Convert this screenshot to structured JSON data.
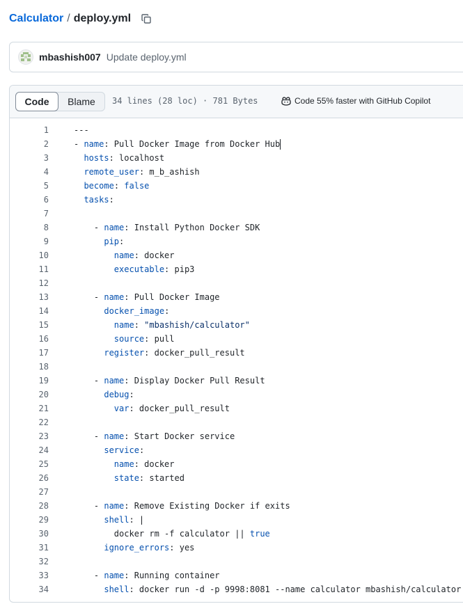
{
  "breadcrumb": {
    "repo": "Calculator",
    "separator": "/",
    "file": "deploy.yml"
  },
  "commit": {
    "author": "mbashish007",
    "message": "Update deploy.yml"
  },
  "file_header": {
    "tab_code": "Code",
    "tab_blame": "Blame",
    "meta": "34 lines (28 loc) · 781 Bytes",
    "copilot": "Code 55% faster with GitHub Copilot"
  },
  "colors": {
    "link": "#0969da",
    "yaml_key": "#0550ae",
    "yaml_string": "#0a3069",
    "text": "#1f2328",
    "muted": "#59636e",
    "border": "#d1d9e0"
  },
  "code_lines": [
    {
      "n": "1",
      "parts": [
        [
          "t",
          "---"
        ]
      ]
    },
    {
      "n": "2",
      "parts": [
        [
          "t",
          "- "
        ],
        [
          "k",
          "name"
        ],
        [
          "t",
          ": Pull Docker Image from Docker Hub"
        ]
      ],
      "caret": true
    },
    {
      "n": "3",
      "parts": [
        [
          "t",
          "  "
        ],
        [
          "k",
          "hosts"
        ],
        [
          "t",
          ": localhost"
        ]
      ]
    },
    {
      "n": "4",
      "parts": [
        [
          "t",
          "  "
        ],
        [
          "k",
          "remote_user"
        ],
        [
          "t",
          ": m_b_ashish"
        ]
      ]
    },
    {
      "n": "5",
      "parts": [
        [
          "t",
          "  "
        ],
        [
          "k",
          "become"
        ],
        [
          "t",
          ": "
        ],
        [
          "b",
          "false"
        ]
      ]
    },
    {
      "n": "6",
      "parts": [
        [
          "t",
          "  "
        ],
        [
          "k",
          "tasks"
        ],
        [
          "t",
          ":"
        ]
      ]
    },
    {
      "n": "7",
      "parts": []
    },
    {
      "n": "8",
      "parts": [
        [
          "t",
          "    - "
        ],
        [
          "k",
          "name"
        ],
        [
          "t",
          ": Install Python Docker SDK"
        ]
      ]
    },
    {
      "n": "9",
      "parts": [
        [
          "t",
          "      "
        ],
        [
          "k",
          "pip"
        ],
        [
          "t",
          ":"
        ]
      ]
    },
    {
      "n": "10",
      "parts": [
        [
          "t",
          "        "
        ],
        [
          "k",
          "name"
        ],
        [
          "t",
          ": docker"
        ]
      ]
    },
    {
      "n": "11",
      "parts": [
        [
          "t",
          "        "
        ],
        [
          "k",
          "executable"
        ],
        [
          "t",
          ": pip3"
        ]
      ]
    },
    {
      "n": "12",
      "parts": []
    },
    {
      "n": "13",
      "parts": [
        [
          "t",
          "    - "
        ],
        [
          "k",
          "name"
        ],
        [
          "t",
          ": Pull Docker Image"
        ]
      ]
    },
    {
      "n": "14",
      "parts": [
        [
          "t",
          "      "
        ],
        [
          "k",
          "docker_image"
        ],
        [
          "t",
          ":"
        ]
      ]
    },
    {
      "n": "15",
      "parts": [
        [
          "t",
          "        "
        ],
        [
          "k",
          "name"
        ],
        [
          "t",
          ": "
        ],
        [
          "s",
          "\"mbashish/calculator\""
        ]
      ]
    },
    {
      "n": "16",
      "parts": [
        [
          "t",
          "        "
        ],
        [
          "k",
          "source"
        ],
        [
          "t",
          ": pull"
        ]
      ]
    },
    {
      "n": "17",
      "parts": [
        [
          "t",
          "      "
        ],
        [
          "k",
          "register"
        ],
        [
          "t",
          ": docker_pull_result"
        ]
      ]
    },
    {
      "n": "18",
      "parts": []
    },
    {
      "n": "19",
      "parts": [
        [
          "t",
          "    - "
        ],
        [
          "k",
          "name"
        ],
        [
          "t",
          ": Display Docker Pull Result"
        ]
      ]
    },
    {
      "n": "20",
      "parts": [
        [
          "t",
          "      "
        ],
        [
          "k",
          "debug"
        ],
        [
          "t",
          ":"
        ]
      ]
    },
    {
      "n": "21",
      "parts": [
        [
          "t",
          "        "
        ],
        [
          "k",
          "var"
        ],
        [
          "t",
          ": docker_pull_result"
        ]
      ]
    },
    {
      "n": "22",
      "parts": []
    },
    {
      "n": "23",
      "parts": [
        [
          "t",
          "    - "
        ],
        [
          "k",
          "name"
        ],
        [
          "t",
          ": Start Docker service"
        ]
      ]
    },
    {
      "n": "24",
      "parts": [
        [
          "t",
          "      "
        ],
        [
          "k",
          "service"
        ],
        [
          "t",
          ":"
        ]
      ]
    },
    {
      "n": "25",
      "parts": [
        [
          "t",
          "        "
        ],
        [
          "k",
          "name"
        ],
        [
          "t",
          ": docker"
        ]
      ]
    },
    {
      "n": "26",
      "parts": [
        [
          "t",
          "        "
        ],
        [
          "k",
          "state"
        ],
        [
          "t",
          ": started"
        ]
      ]
    },
    {
      "n": "27",
      "parts": []
    },
    {
      "n": "28",
      "parts": [
        [
          "t",
          "    - "
        ],
        [
          "k",
          "name"
        ],
        [
          "t",
          ": Remove Existing Docker if exits"
        ]
      ]
    },
    {
      "n": "29",
      "parts": [
        [
          "t",
          "      "
        ],
        [
          "k",
          "shell"
        ],
        [
          "t",
          ": |"
        ]
      ]
    },
    {
      "n": "30",
      "parts": [
        [
          "t",
          "        docker rm -f calculator || "
        ],
        [
          "b",
          "true"
        ]
      ]
    },
    {
      "n": "31",
      "parts": [
        [
          "t",
          "      "
        ],
        [
          "k",
          "ignore_errors"
        ],
        [
          "t",
          ": yes"
        ]
      ]
    },
    {
      "n": "32",
      "parts": []
    },
    {
      "n": "33",
      "parts": [
        [
          "t",
          "    - "
        ],
        [
          "k",
          "name"
        ],
        [
          "t",
          ": Running container"
        ]
      ]
    },
    {
      "n": "34",
      "parts": [
        [
          "t",
          "      "
        ],
        [
          "k",
          "shell"
        ],
        [
          "t",
          ": docker run -d -p 9998:8081 --name calculator mbashish/calculator"
        ]
      ]
    }
  ]
}
